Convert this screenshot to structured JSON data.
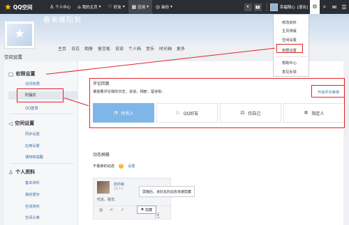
{
  "topbar": {
    "logo": "QQ空间",
    "nav": [
      {
        "icon": "user-icon",
        "glyph": "♙",
        "label": "个人中心"
      },
      {
        "icon": "home-icon",
        "glyph": "⌂",
        "label": "我的主页",
        "caret": "▾"
      },
      {
        "icon": "friends-icon",
        "glyph": "♡",
        "label": "好友",
        "caret": "▾"
      },
      {
        "icon": "apps-icon",
        "glyph": "▦",
        "label": "应用",
        "caret": "▾"
      },
      {
        "icon": "game-icon",
        "glyph": "◎",
        "label": "装扮",
        "caret": "▾"
      }
    ],
    "sq1": "⏸",
    "sq2": "▮▮",
    "user_name": "幸福随心",
    "exit": "[退出]",
    "gear": "⚙",
    "search": "⌕",
    "mail": "✉",
    "menu": "☰"
  },
  "banner": {
    "name": "春来暖阳到",
    "tabs": [
      "主页",
      "日志",
      "相册",
      "留言板",
      "说说",
      "个人档",
      "音乐",
      "时光轴",
      "更多"
    ]
  },
  "dropdown": {
    "items": [
      "修改资料",
      "主页排版",
      "空间设置",
      "权限设置",
      "帮助中心",
      "意见反馈"
    ]
  },
  "sidebar": {
    "page_title": "空间设置",
    "sections": [
      {
        "title": "权限设置",
        "glyph": "▢",
        "items": [
          "访问权限",
          "防骚扰",
          "QQ登录"
        ]
      },
      {
        "title": "空间设置",
        "glyph": "◁",
        "items": [
          "同步设置",
          "应用设置",
          "通知和提醒"
        ]
      },
      {
        "title": "个人资料",
        "glyph": "♙",
        "items": [
          "基本资料",
          "我的爱好",
          "空间资料",
          "空间头像"
        ]
      }
    ]
  },
  "comment": {
    "label": "评论回复",
    "desc": "谁能看评论我的日志，说说，相册，留言板：",
    "open_audit": "开启评论审核",
    "options": [
      {
        "icon": "globe-icon",
        "glyph": "◔",
        "label": "所有人",
        "selected": true
      },
      {
        "icon": "qq-friend-icon",
        "glyph": "♘",
        "label": "QQ好友",
        "selected": false
      },
      {
        "icon": "lock-icon",
        "glyph": "⊡",
        "label": "仅自己",
        "selected": false
      },
      {
        "icon": "settings-icon",
        "glyph": "✲",
        "label": "指定人",
        "selected": false
      }
    ]
  },
  "dynamic": {
    "title": "动态屏蔽",
    "sub": "不看谁的动态",
    "help": "?",
    "setting": "设置",
    "feed": {
      "name": "张的每",
      "time": "14:13",
      "text": "吃饭，睡觉。",
      "actions": [
        "▤",
        "✍",
        "↗"
      ],
      "hide_label": "隐藏",
      "hide_glyph": "✖"
    },
    "tooltip": "屏蔽后，该好友的动态将被隐藏",
    "cursor": "☝"
  }
}
